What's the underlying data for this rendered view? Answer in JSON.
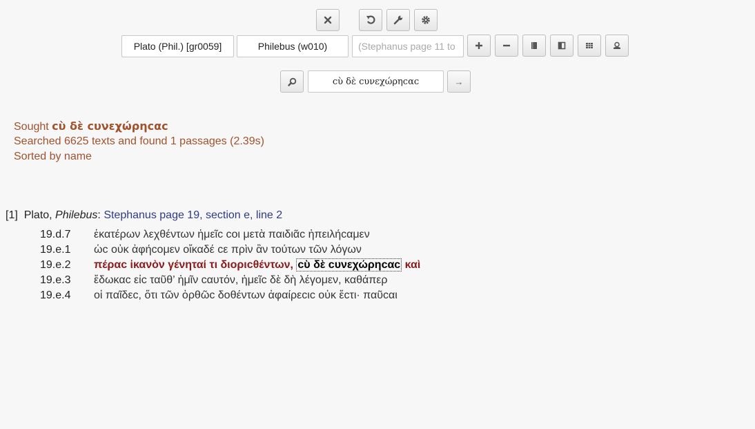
{
  "toolbar_top": {
    "close": "close-icon",
    "undo": "undo-icon",
    "tools": "wrench-icon",
    "settings": "gear-icon"
  },
  "selectors": {
    "author": "Plato (Phil.) [gr0059]",
    "work": "Philebus (w010)",
    "passage_placeholder": "(Stephanus page 11 to"
  },
  "toolbar_right": {
    "add": "+",
    "remove": "−",
    "b1": "book-icon",
    "b2": "split-book-icon",
    "b3": "grid-icon",
    "b4": "user-icon"
  },
  "search": {
    "value": "cὺ δὲ cυνεχώρηcαc",
    "go": "→"
  },
  "summary": {
    "sought_label": "Sought ",
    "sought_term": "cὺ δὲ cυνεχώρηcαc",
    "searched": "Searched 6625 texts and found 1 passages (2.39s)",
    "sorted": "Sorted by name"
  },
  "result": {
    "index": "[1]",
    "author": "Plato, ",
    "work": "Philebus",
    "sep": ": ",
    "location": "Stephanus page 19, section e, line 2",
    "lines": [
      {
        "ref": "19.d.7",
        "text": "ἑκατέρων λεχθέντων ἡμεῖc coι μετὰ παιδιᾶc ἠπειλήcαμεν"
      },
      {
        "ref": "19.e.1",
        "text": "ὡc οὐκ ἀφήcομεν οἴκαδέ cε πρὶν ἂν τούτων τῶν λόγων"
      },
      {
        "ref": "19.e.2",
        "pre": "πέραc ἱκανὸν γένηταί τι διοριcθέντων, ",
        "match": "cὺ δὲ cυνεχώρηcαc",
        "post": " καὶ"
      },
      {
        "ref": "19.e.3",
        "text": "ἔδωκαc εἰc ταῦθ’ ἡμῖν cαυτόν, ἡμεῖc δὲ δὴ λέγομεν, καθάπερ"
      },
      {
        "ref": "19.e.4",
        "text": "οἱ παῖδεc, ὅτι τῶν ὀρθῶc δοθέντων ἀφαίρεcιc οὐκ ἔcτι· παῦcαι"
      }
    ]
  }
}
